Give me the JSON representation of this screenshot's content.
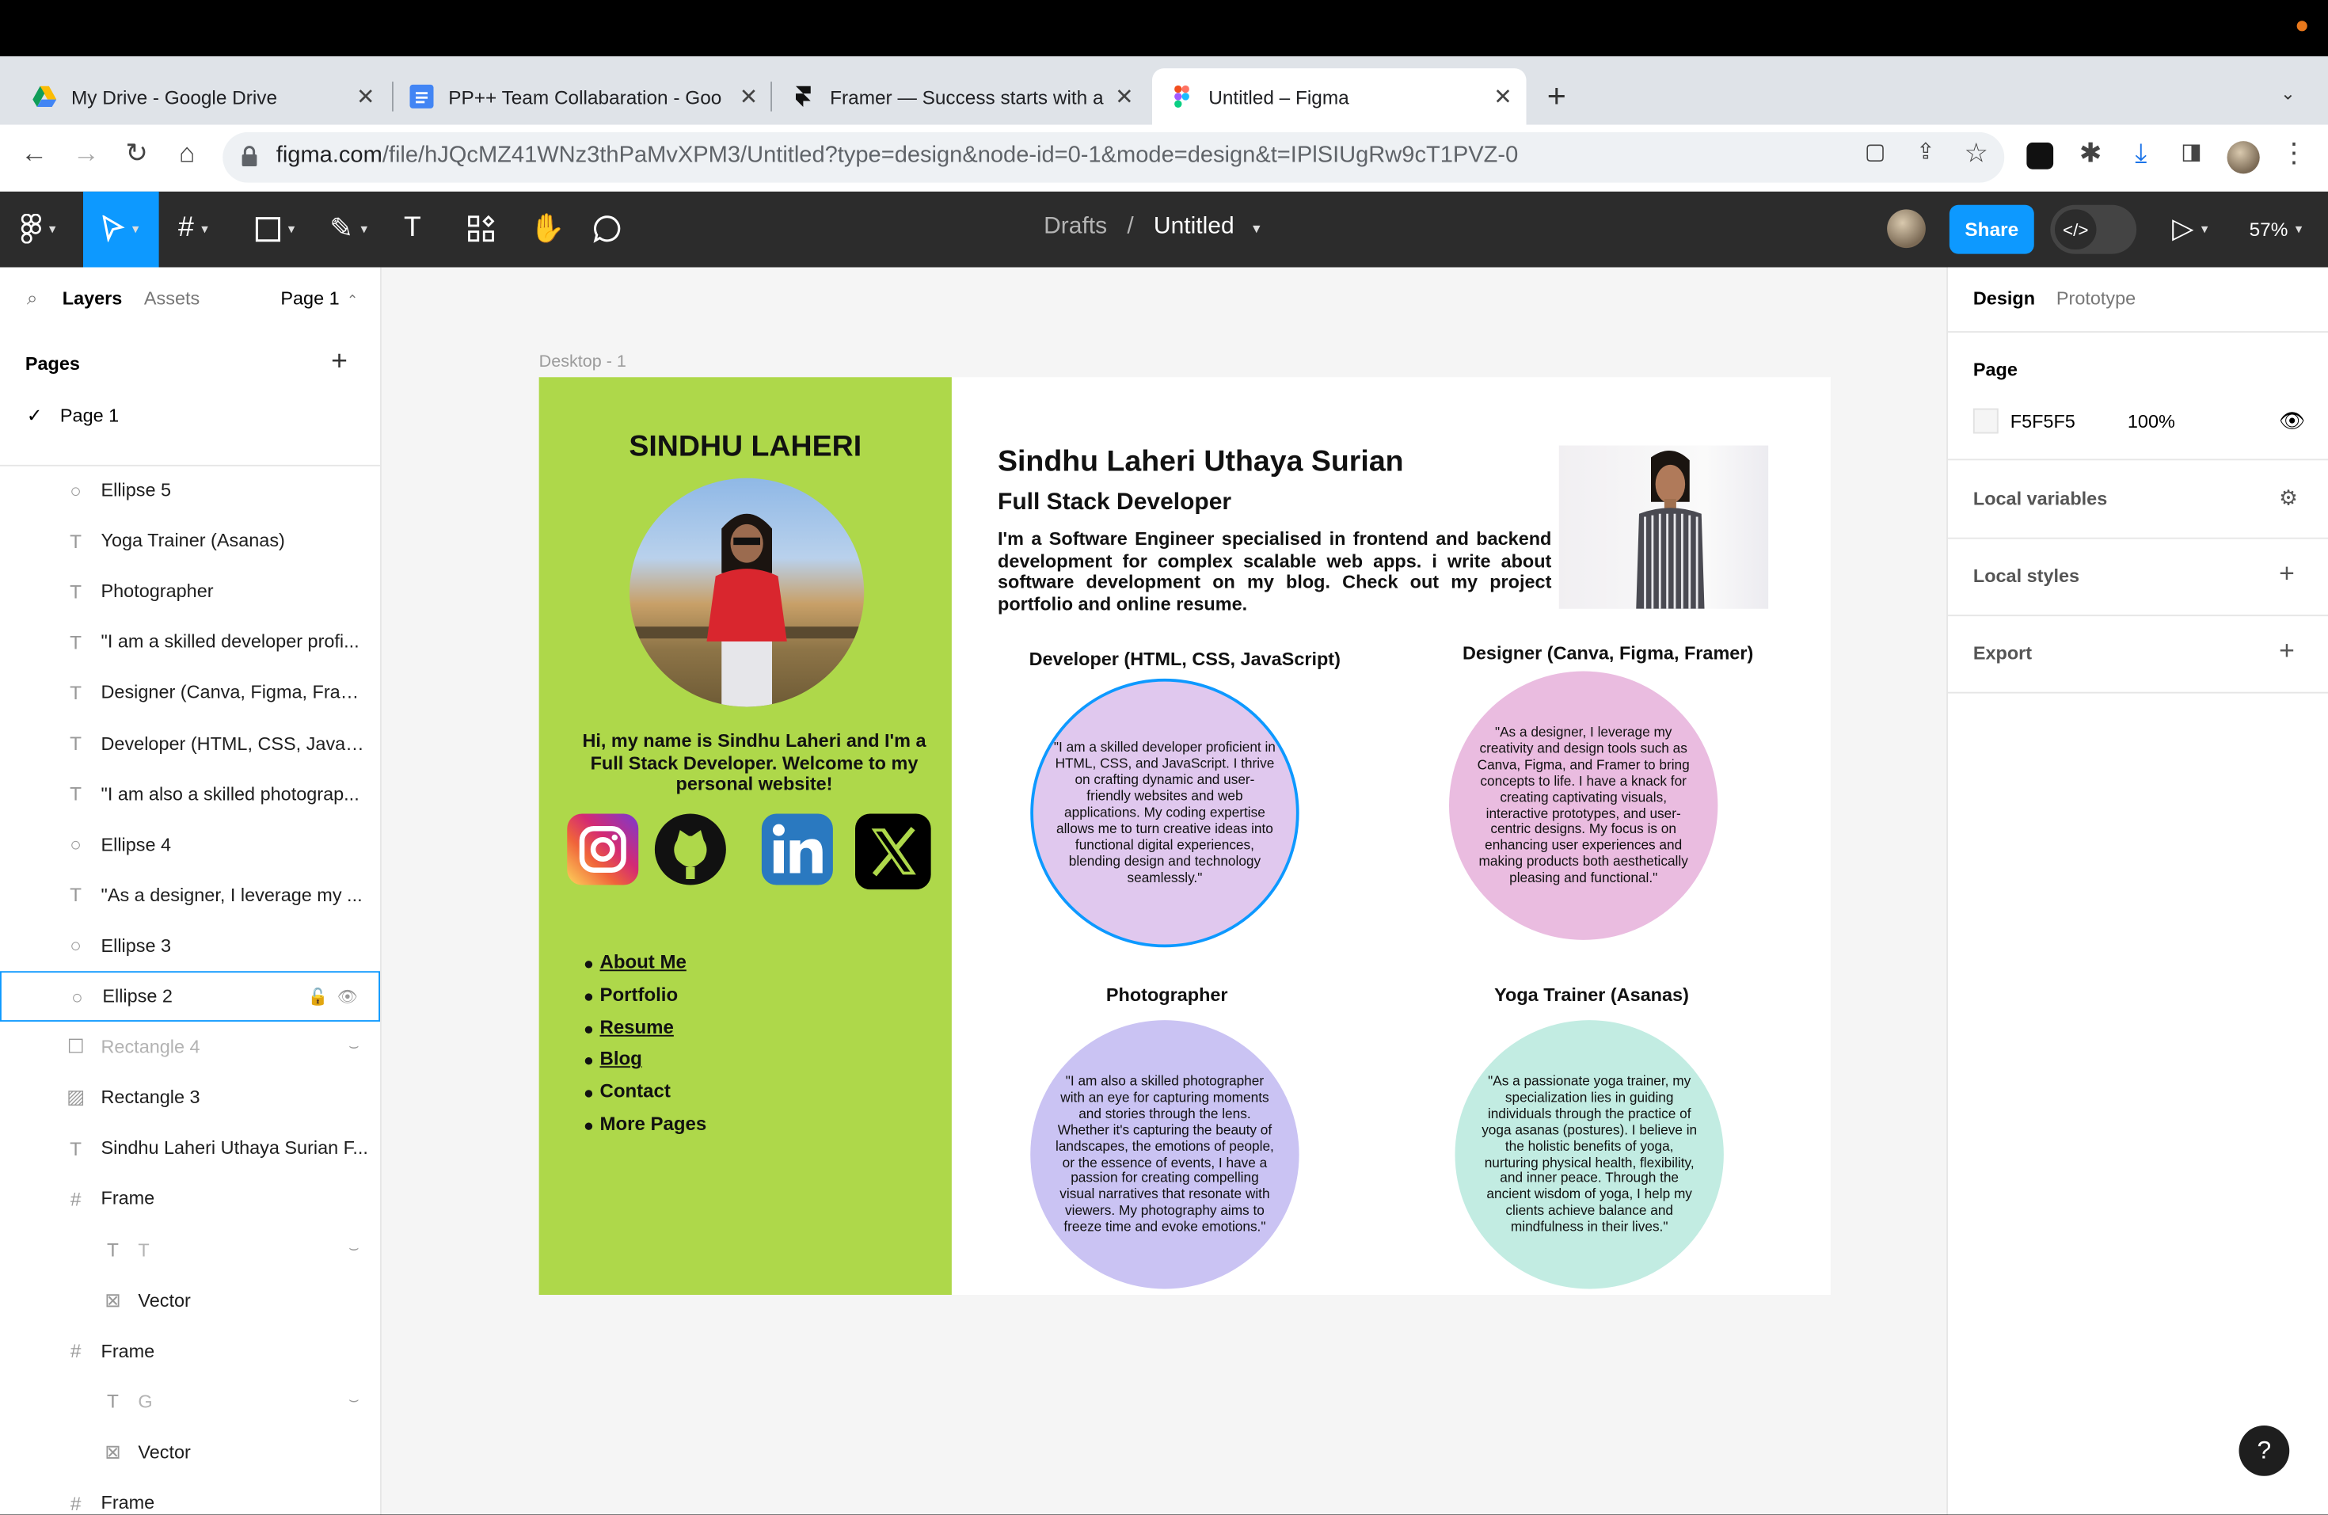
{
  "browser": {
    "tabs": [
      {
        "title": "My Drive - Google Drive"
      },
      {
        "title": "PP++ Team Collabaration - Goo"
      },
      {
        "title": "Framer — Success starts with a"
      },
      {
        "title": "Untitled – Figma"
      }
    ],
    "url_domain": "figma.com",
    "url_path": "/file/hJQcMZ41WNz3thPaMvXPM3/Untitled?type=design&node-id=0-1&mode=design&t=IPlSIUgRw9cT1PVZ-0"
  },
  "toolbar": {
    "breadcrumb_parent": "Drafts",
    "breadcrumb_sep": "/",
    "file_name": "Untitled",
    "share_label": "Share",
    "zoom": "57%",
    "accent_color": "#0d99ff"
  },
  "left_panel": {
    "tab_layers": "Layers",
    "tab_assets": "Assets",
    "page_selector": "Page 1",
    "pages_heading": "Pages",
    "pages": [
      "Page 1"
    ],
    "layers": [
      {
        "name": "Ellipse 5",
        "icon": "ellipse-icon"
      },
      {
        "name": "Yoga Trainer (Asanas)",
        "icon": "text-icon"
      },
      {
        "name": "Photographer",
        "icon": "text-icon"
      },
      {
        "name": "\"I am a skilled developer profi...",
        "icon": "text-icon"
      },
      {
        "name": "Designer (Canva, Figma, Fram...",
        "icon": "text-icon"
      },
      {
        "name": "Developer (HTML, CSS, JavaS...",
        "icon": "text-icon"
      },
      {
        "name": "\"I am also a skilled photograp...",
        "icon": "text-icon"
      },
      {
        "name": "Ellipse 4",
        "icon": "ellipse-icon"
      },
      {
        "name": "\"As a designer, I leverage my ...",
        "icon": "text-icon"
      },
      {
        "name": "Ellipse 3",
        "icon": "ellipse-icon"
      },
      {
        "name": "Ellipse 2",
        "icon": "ellipse-icon",
        "selected": true
      },
      {
        "name": "Rectangle 4",
        "icon": "rectangle-icon",
        "hidden": true
      },
      {
        "name": "Rectangle 3",
        "icon": "image-icon"
      },
      {
        "name": "Sindhu Laheri Uthaya Surian F...",
        "icon": "text-icon"
      },
      {
        "name": "Frame",
        "icon": "frame-icon"
      },
      {
        "name": "T",
        "icon": "text-icon",
        "hidden": true,
        "indent": true
      },
      {
        "name": "Vector",
        "icon": "vector-icon",
        "indent": true
      },
      {
        "name": "Frame",
        "icon": "frame-icon"
      },
      {
        "name": "G",
        "icon": "text-icon",
        "hidden": true,
        "indent": true
      },
      {
        "name": "Vector",
        "icon": "vector-icon",
        "indent": true
      },
      {
        "name": "Frame",
        "icon": "frame-icon"
      }
    ]
  },
  "right_panel": {
    "tab_design": "Design",
    "tab_prototype": "Prototype",
    "page_heading": "Page",
    "bg_color": "F5F5F5",
    "bg_opacity": "100%",
    "local_variables": "Local variables",
    "local_styles": "Local styles",
    "export": "Export"
  },
  "canvas": {
    "frame_label": "Desktop - 1",
    "sidebar_name": "SINDHU LAHERI",
    "intro": "Hi, my name is Sindhu Laheri and I'm a Full Stack Developer. Welcome to my personal website!",
    "nav": [
      {
        "label": "About Me",
        "underlined": true
      },
      {
        "label": "Portfolio",
        "underlined": false
      },
      {
        "label": "Resume",
        "underlined": true
      },
      {
        "label": "Blog",
        "underlined": true
      },
      {
        "label": "Contact",
        "underlined": false
      },
      {
        "label": "More Pages",
        "underlined": false
      }
    ],
    "social_icons": [
      "instagram-icon",
      "github-icon",
      "linkedin-icon",
      "x-icon"
    ],
    "full_name": "Sindhu Laheri Uthaya Surian",
    "role": "Full Stack Developer",
    "description": "I'm a Software Engineer specialised in frontend and backend development for complex scalable web apps. i write about software development on my blog. Check out my project portfolio and online resume.",
    "cards": [
      {
        "title": "Developer (HTML, CSS, JavaScript)",
        "text": "\"I am a skilled developer proficient in HTML, CSS, and JavaScript. I thrive on crafting dynamic and user-friendly websites and web applications. My coding expertise allows me to turn creative ideas into functional digital experiences, blending design and technology seamlessly.\"",
        "color": "#e0c8ee"
      },
      {
        "title": "Designer (Canva, Figma, Framer)",
        "text": "\"As a designer, I leverage my creativity and design tools such as Canva, Figma, and Framer to bring concepts to life. I have a knack for creating captivating visuals, interactive prototypes, and user-centric designs. My focus is on enhancing user experiences and making products both aesthetically pleasing and functional.\"",
        "color": "#eabce0"
      },
      {
        "title": "Photographer",
        "text": "\"I am also a skilled photographer with an eye for capturing moments and stories through the lens. Whether it's capturing the beauty of landscapes, the emotions of people, or the essence of events, I have a passion for creating compelling visual narratives that resonate with viewers. My photography aims to freeze time and evoke emotions.\"",
        "color": "#cac3f3"
      },
      {
        "title": "Yoga Trainer (Asanas)",
        "text": "\"As a passionate yoga trainer, my specialization lies in guiding individuals through the practice of yoga asanas (postures). I believe in the holistic benefits of yoga, nurturing physical health, flexibility, and inner peace. Through the ancient wisdom of yoga, I help my clients achieve balance and mindfulness in their lives.\"",
        "color": "#c2ece2"
      }
    ],
    "sidebar_color": "#aed84a"
  },
  "help_label": "?"
}
